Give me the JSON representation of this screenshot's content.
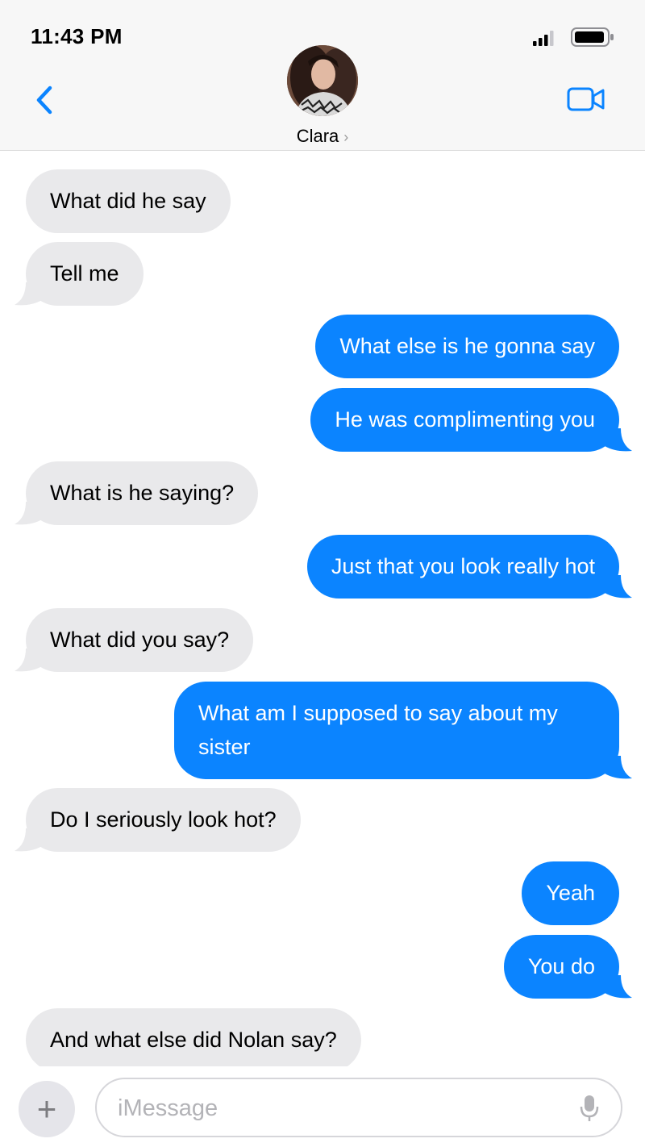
{
  "status_bar": {
    "time": "11:43 PM"
  },
  "header": {
    "contact_name": "Clara",
    "contact_chevron": "›"
  },
  "messages": [
    {
      "dir": "in",
      "text": "What did he say"
    },
    {
      "dir": "in",
      "text": "Tell me"
    },
    {
      "dir": "out",
      "text": "What else is he gonna say"
    },
    {
      "dir": "out",
      "text": "He was complimenting you"
    },
    {
      "dir": "in",
      "text": "What is he saying?"
    },
    {
      "dir": "out",
      "text": "Just that you look really hot"
    },
    {
      "dir": "in",
      "text": "What did you say?"
    },
    {
      "dir": "out",
      "text": "What am I supposed to say about my sister"
    },
    {
      "dir": "in",
      "text": "Do I seriously look hot?"
    },
    {
      "dir": "out",
      "text": "Yeah"
    },
    {
      "dir": "out",
      "text": "You do"
    },
    {
      "dir": "in",
      "text": "And what else did Nolan say?"
    }
  ],
  "composer": {
    "placeholder": "iMessage",
    "plus_label": "+"
  },
  "icons": {
    "back": "chevron-left-icon",
    "video": "video-camera-icon",
    "signal": "cellular-signal-icon",
    "battery": "battery-icon",
    "mic": "microphone-icon"
  },
  "colors": {
    "accent": "#0b84ff",
    "incoming_bubble": "#e9e9eb",
    "header_bg": "#f7f7f7"
  }
}
